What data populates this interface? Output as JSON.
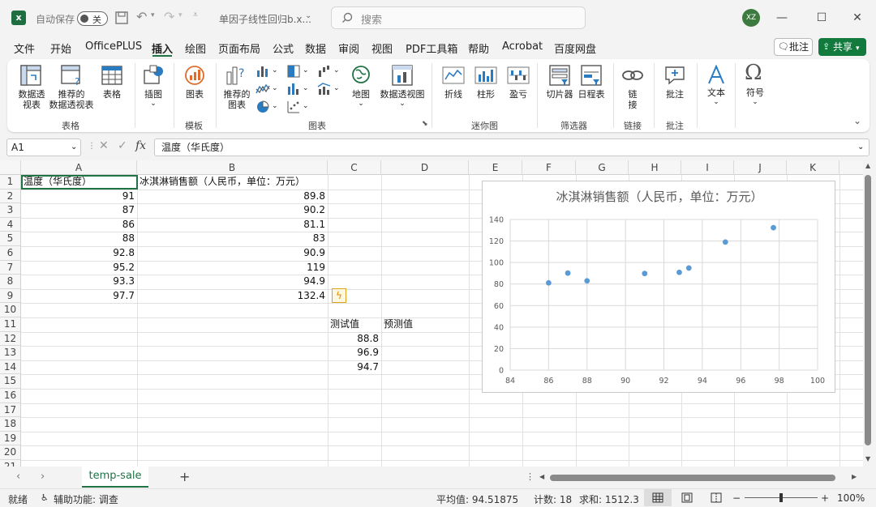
{
  "titlebar": {
    "autosave_label": "自动保存",
    "autosave_state": "关",
    "filename": "单因子线性回归b.x...",
    "search_placeholder": "搜索",
    "avatar": "XZ"
  },
  "menu": {
    "items": [
      "文件",
      "开始",
      "OfficePLUS",
      "插入",
      "绘图",
      "页面布局",
      "公式",
      "数据",
      "审阅",
      "视图",
      "PDF工具箱",
      "帮助",
      "Acrobat",
      "百度网盘"
    ],
    "active": "插入",
    "comment": "批注",
    "share": "共享"
  },
  "ribbon": {
    "pivot": "数据透\n视表",
    "rec_pivot": "推荐的\n数据透视表",
    "table": "表格",
    "illustrations": "插图",
    "icon_chart": "图表",
    "rec_charts": "推荐的\n图表",
    "map": "地图",
    "pivot_chart": "数据透视图",
    "line": "折线",
    "column": "柱形",
    "winloss": "盈亏",
    "slicer": "切片器",
    "timeline": "日程表",
    "link": "链\n接",
    "comment": "批注",
    "text": "文本",
    "symbol": "符号",
    "groups": {
      "tables": "表格",
      "templates": "模板",
      "charts": "图表",
      "sparklines": "迷你图",
      "filters": "筛选器",
      "links": "链接",
      "comments": "批注"
    }
  },
  "formula": {
    "namebox": "A1",
    "fx": "fx",
    "content": "温度（华氏度）"
  },
  "sheet": {
    "columns": [
      "A",
      "B",
      "C",
      "D",
      "E",
      "F",
      "G",
      "H",
      "I",
      "J",
      "K"
    ],
    "rows": [
      "1",
      "2",
      "3",
      "4",
      "5",
      "6",
      "7",
      "8",
      "9",
      "10",
      "11",
      "12",
      "13",
      "14",
      "15",
      "16",
      "17",
      "18",
      "19",
      "20",
      "21"
    ],
    "headers": {
      "A": "温度（华氏度）",
      "B": "冰淇淋销售额（人民币，单位：万元）"
    },
    "temps": [
      "91",
      "87",
      "86",
      "88",
      "92.8",
      "95.2",
      "93.3",
      "97.7"
    ],
    "sales": [
      "89.8",
      "90.2",
      "81.1",
      "83",
      "90.9",
      "119",
      "94.9",
      "132.4"
    ],
    "test_header": "测试值",
    "pred_header": "预测值",
    "tests": [
      "88.8",
      "96.9",
      "94.7"
    ]
  },
  "chart_data": {
    "type": "scatter",
    "title": "冰淇淋销售额（人民币，单位：万元）",
    "x": [
      91,
      87,
      86,
      88,
      92.8,
      95.2,
      93.3,
      97.7
    ],
    "y": [
      89.8,
      90.2,
      81.1,
      83,
      90.9,
      119,
      94.9,
      132.4
    ],
    "xlim": [
      84,
      100
    ],
    "ylim": [
      0,
      140
    ],
    "xticks": [
      84,
      86,
      88,
      90,
      92,
      94,
      96,
      98,
      100
    ],
    "yticks": [
      0,
      20,
      40,
      60,
      80,
      100,
      120,
      140
    ],
    "grid": true,
    "point_color": "#5b9bd5"
  },
  "tabs": {
    "sheet": "temp-sale",
    "add": "+"
  },
  "status": {
    "ready": "就绪",
    "accessibility": "辅助功能: 调查",
    "average": "平均值: 94.51875",
    "count": "计数: 18",
    "sum": "求和: 1512.3",
    "zoom": "100%",
    "minus": "−",
    "plus": "+"
  }
}
